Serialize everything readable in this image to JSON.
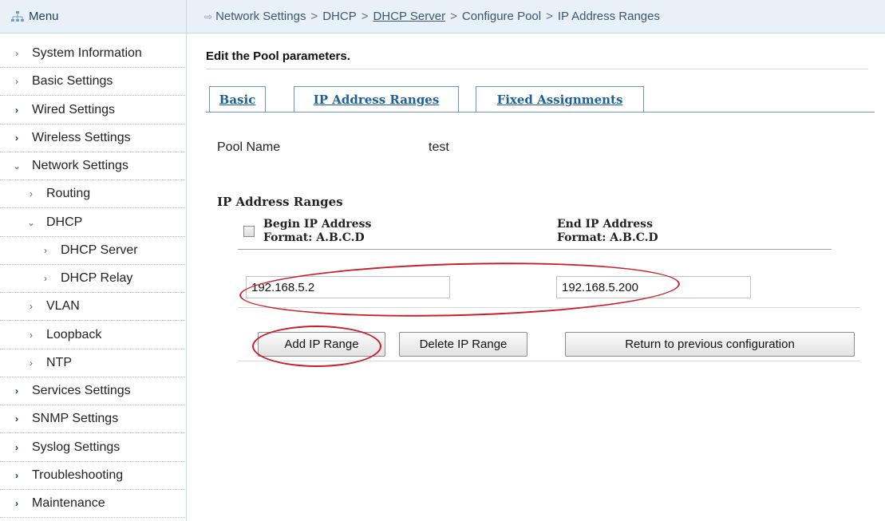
{
  "sidebar": {
    "menu_title": "Menu",
    "items": [
      {
        "label": "System Information",
        "level": 0,
        "chevron": "›"
      },
      {
        "label": "Basic Settings",
        "level": 0,
        "chevron": "›"
      },
      {
        "label": "Wired Settings",
        "level": 0,
        "chevron": "›"
      },
      {
        "label": "Wireless Settings",
        "level": 0,
        "chevron": "›"
      },
      {
        "label": "Network Settings",
        "level": 0,
        "chevron": "⌄"
      },
      {
        "label": "Routing",
        "level": 1,
        "chevron": "›"
      },
      {
        "label": "DHCP",
        "level": 1,
        "chevron": "⌄"
      },
      {
        "label": "DHCP Server",
        "level": 2,
        "chevron": "›"
      },
      {
        "label": "DHCP Relay",
        "level": 2,
        "chevron": "›"
      },
      {
        "label": "VLAN",
        "level": 1,
        "chevron": "›"
      },
      {
        "label": "Loopback",
        "level": 1,
        "chevron": "›"
      },
      {
        "label": "NTP",
        "level": 1,
        "chevron": "›"
      },
      {
        "label": "Services Settings",
        "level": 0,
        "chevron": "›"
      },
      {
        "label": "SNMP Settings",
        "level": 0,
        "chevron": "›"
      },
      {
        "label": "Syslog Settings",
        "level": 0,
        "chevron": "›"
      },
      {
        "label": "Troubleshooting",
        "level": 0,
        "chevron": "›"
      },
      {
        "label": "Maintenance",
        "level": 0,
        "chevron": "›"
      }
    ]
  },
  "breadcrumb": {
    "arrow": "⇨",
    "separator": ">",
    "parts": [
      "Network Settings",
      "DHCP",
      "DHCP Server",
      "Configure Pool",
      "IP Address Ranges"
    ]
  },
  "page": {
    "title": "Edit the Pool parameters."
  },
  "tabs": [
    {
      "label": "Basic"
    },
    {
      "label": "IP Address Ranges"
    },
    {
      "label": "Fixed Assignments"
    }
  ],
  "pool": {
    "name_label": "Pool Name",
    "name_value": "test"
  },
  "ranges": {
    "section_title": "IP Address Ranges",
    "begin_header": "Begin IP Address",
    "begin_format": "Format: A.B.C.D",
    "end_header": "End IP Address",
    "end_format": "Format: A.B.C.D",
    "begin_value": "192.168.5.2",
    "end_value": "192.168.5.200"
  },
  "buttons": {
    "add": "Add IP Range",
    "delete": "Delete IP Range",
    "return": "Return to previous configuration"
  },
  "colors": {
    "annotation": "#c91f2a",
    "tab_text": "#1f5f99",
    "header_bg": "#e8f1f8"
  }
}
